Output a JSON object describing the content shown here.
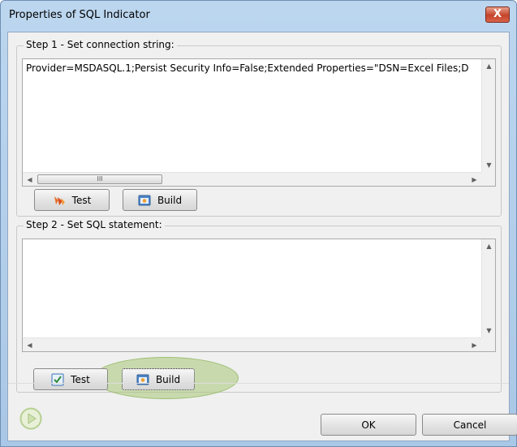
{
  "window": {
    "title": "Properties of SQL Indicator",
    "close_label": "X"
  },
  "step1": {
    "label": "Step 1 - Set connection string:",
    "connection_string": "Provider=MSDASQL.1;Persist Security Info=False;Extended Properties=\"DSN=Excel Files;D",
    "test_label": "Test",
    "build_label": "Build",
    "scroll_thumb_grip": "III"
  },
  "step2": {
    "label": "Step 2 - Set SQL statement:",
    "sql_statement": "",
    "test_label": "Test",
    "build_label": "Build"
  },
  "footer": {
    "ok_label": "OK",
    "cancel_label": "Cancel"
  },
  "colors": {
    "highlight": "#a8c876",
    "title_gradient_top": "#bcd6ef",
    "close_button": "#c4432a"
  },
  "icons": {
    "test1": "flame-icon",
    "build": "window-build-icon",
    "test2": "checkbox-icon",
    "play": "play-icon"
  }
}
